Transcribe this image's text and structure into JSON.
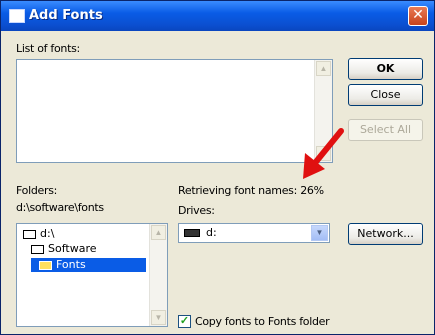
{
  "window": {
    "title": "Add Fonts",
    "close_glyph": "✕"
  },
  "fonts_list": {
    "label": "List of fonts:"
  },
  "folders": {
    "label": "Folders:",
    "path": "d:\\software\\fonts",
    "tree": [
      {
        "label": "d:\\",
        "icon": "open-folder-icon"
      },
      {
        "label": "Software",
        "icon": "open-folder-icon"
      },
      {
        "label": "Fonts",
        "icon": "open-folder-icon",
        "selected": true
      }
    ]
  },
  "status": {
    "retrieving": "Retrieving font names: 26%"
  },
  "drives": {
    "label": "Drives:",
    "selected": "d:",
    "icon": "drive-icon"
  },
  "buttons": {
    "ok": "OK",
    "close": "Close",
    "select_all": "Select All",
    "network": "Network..."
  },
  "copy_checkbox": {
    "label": "Copy fonts to Fonts folder",
    "checked": true,
    "glyph": "✓"
  },
  "colors": {
    "titlebar": "#0a5ce6",
    "selection": "#0a5ce6",
    "arrow": "#e01010"
  }
}
